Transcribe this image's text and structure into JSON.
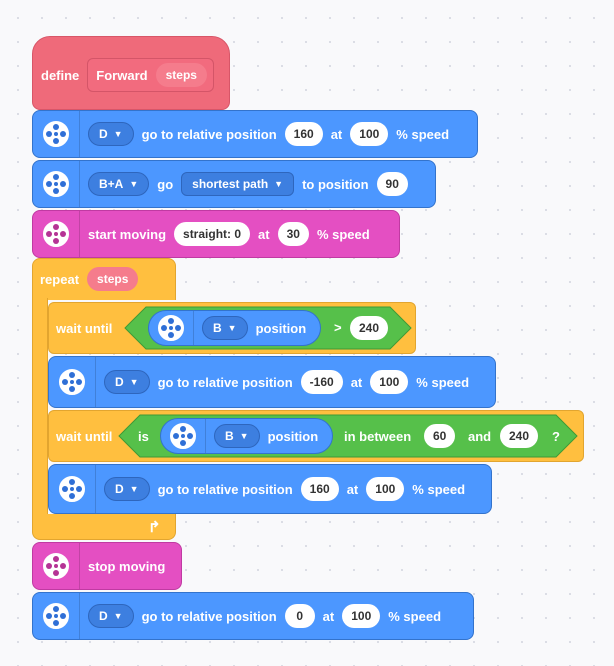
{
  "define": {
    "label": "define",
    "name": "Forward",
    "param": "steps"
  },
  "b1": {
    "port": "D",
    "text1": "go to relative position",
    "position": "160",
    "at": "at",
    "speed": "100",
    "unit": "% speed"
  },
  "b2": {
    "port": "B+A",
    "go": "go",
    "direction": "shortest path",
    "text2": "to position",
    "position": "90"
  },
  "b3": {
    "text1": "start moving",
    "steer": "straight: 0",
    "at": "at",
    "speed": "30",
    "unit": "% speed"
  },
  "repeat": {
    "label": "repeat",
    "param": "steps"
  },
  "w1": {
    "label": "wait until",
    "port": "B",
    "sensor": "position",
    "op": ">",
    "value": "240"
  },
  "b4": {
    "port": "D",
    "text1": "go to relative position",
    "position": "-160",
    "at": "at",
    "speed": "100",
    "unit": "% speed"
  },
  "w2": {
    "label": "wait until",
    "is": "is",
    "port": "B",
    "sensor": "position",
    "between": "in between",
    "low": "60",
    "and": "and",
    "high": "240",
    "q": "?"
  },
  "b5": {
    "port": "D",
    "text1": "go to relative position",
    "position": "160",
    "at": "at",
    "speed": "100",
    "unit": "% speed"
  },
  "b6": {
    "text1": "stop moving"
  },
  "b7": {
    "port": "D",
    "text1": "go to relative position",
    "position": "0",
    "at": "at",
    "speed": "100",
    "unit": "% speed"
  },
  "colors": {
    "motor": "#4c97ff",
    "movement": "#e44fc2",
    "control": "#ffbf3f",
    "sensor": "#56c04a",
    "define": "#ef6a7a"
  },
  "icons": {
    "motor": "motor-wheel-icon",
    "movement": "movement-wheel-icon",
    "loop": "loop-arrow-icon",
    "dropdown": "chevron-down-icon"
  }
}
